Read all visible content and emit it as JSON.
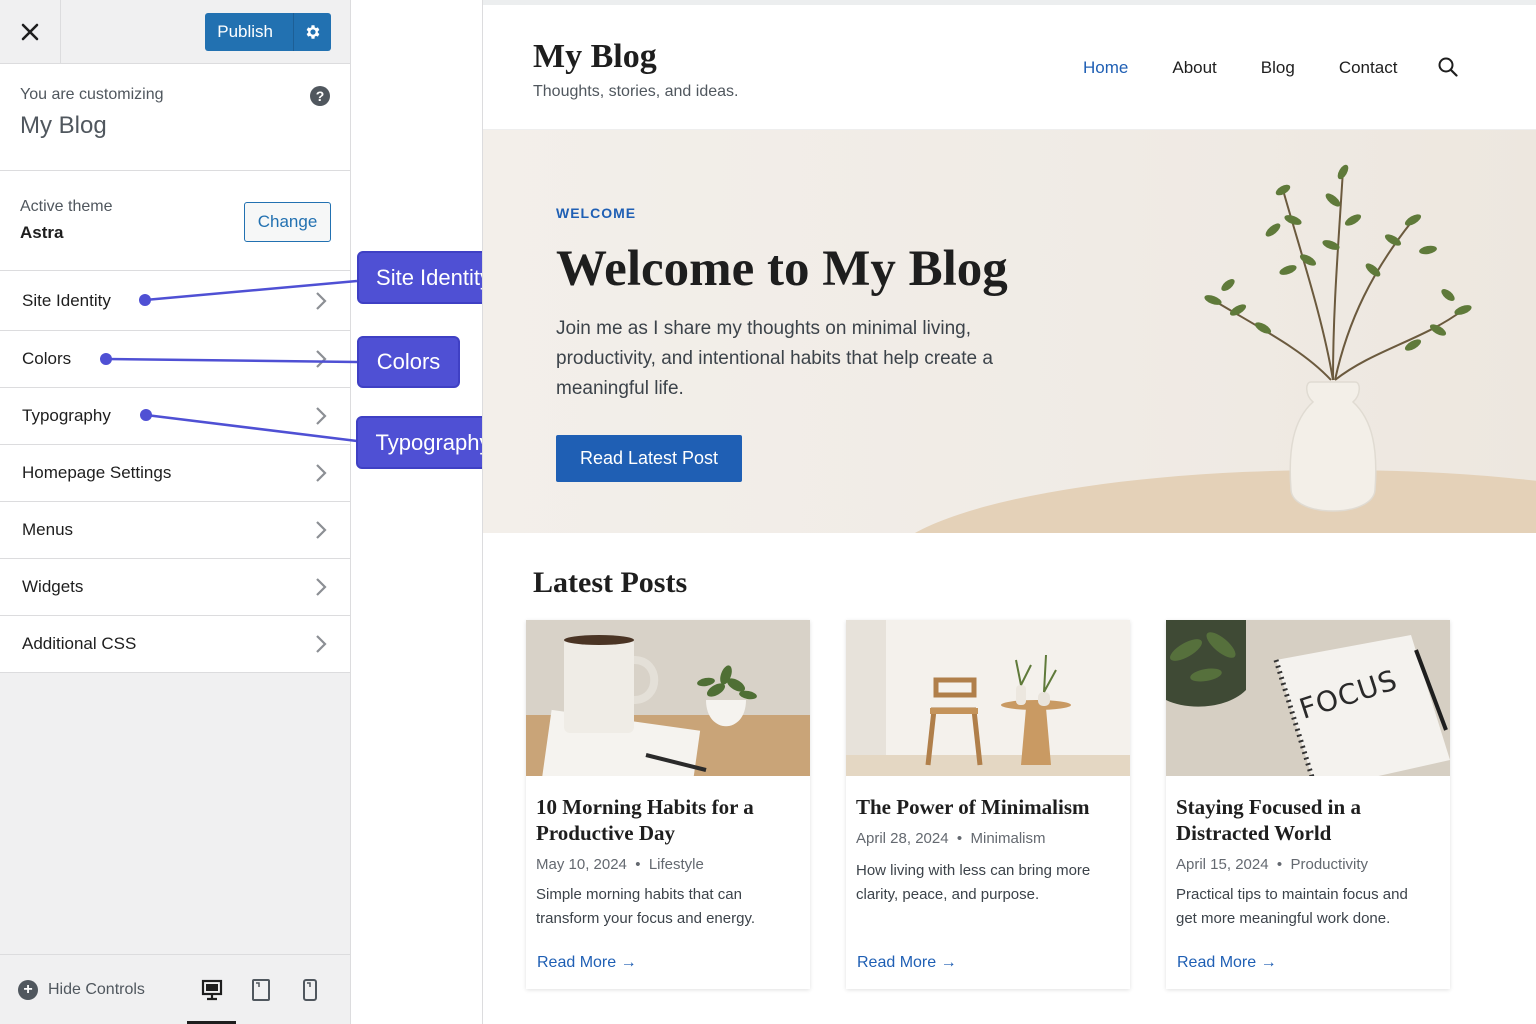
{
  "sidebar": {
    "publish_label": "Publish",
    "customizing_label": "You are customizing",
    "site_name": "My Blog",
    "active_theme_label": "Active theme",
    "theme_name": "Astra",
    "change_label": "Change",
    "items": [
      {
        "label": "Site Identity"
      },
      {
        "label": "Colors"
      },
      {
        "label": "Typography"
      },
      {
        "label": "Homepage Settings"
      },
      {
        "label": "Menus"
      },
      {
        "label": "Widgets"
      },
      {
        "label": "Additional CSS"
      }
    ],
    "hide_controls_label": "Hide Controls"
  },
  "callouts": {
    "site_identity": "Site Identity",
    "colors": "Colors",
    "typography": "Typography"
  },
  "site": {
    "title": "My Blog",
    "tagline": "Thoughts, stories, and ideas.",
    "nav": [
      "Home",
      "About",
      "Blog",
      "Contact"
    ],
    "hero": {
      "eyebrow": "WELCOME",
      "title": "Welcome to My Blog",
      "text": "Join me as I share my thoughts on minimal living, productivity, and intentional habits that help create a meaningful life.",
      "button": "Read Latest Post"
    },
    "latest_title": "Latest Posts",
    "posts": [
      {
        "title": "10 Morning Habits for a Productive Day",
        "date": "May 10, 2024",
        "category": "Lifestyle",
        "excerpt": "Simple morning habits that can transform your focus and energy.",
        "read_more": "Read More"
      },
      {
        "title": "The Power of Minimalism",
        "date": "April 28, 2024",
        "category": "Minimalism",
        "excerpt": "How living with less can bring more clarity, peace, and purpose.",
        "read_more": "Read More"
      },
      {
        "title": "Staying Focused in a Distracted World",
        "date": "April 15, 2024",
        "category": "Productivity",
        "excerpt": "Practical tips to maintain focus and get more meaningful work done.",
        "read_more": "Read More"
      }
    ],
    "notebook_text": "FOCUS"
  },
  "colors": {
    "accent": "#2271b1",
    "link": "#1f5fb4",
    "callout": "#4f50d4"
  }
}
